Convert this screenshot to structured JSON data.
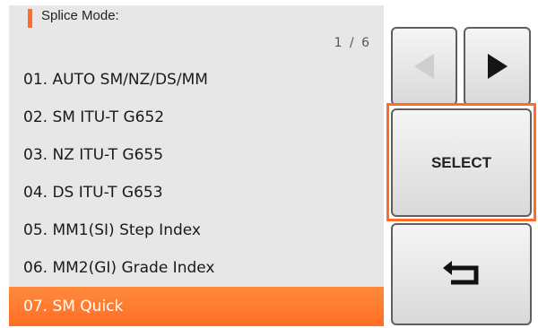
{
  "header": {
    "title": "Splice Mode:"
  },
  "pagination": {
    "indicator": "1 / 6"
  },
  "modes": [
    {
      "label": "01. AUTO SM/NZ/DS/MM"
    },
    {
      "label": "02. SM ITU-T G652"
    },
    {
      "label": "03. NZ ITU-T G655"
    },
    {
      "label": "04. DS ITU-T G653"
    },
    {
      "label": "05. MM1(SI) Step Index"
    },
    {
      "label": "06. MM2(GI) Grade Index"
    },
    {
      "label": "07. SM Quick"
    }
  ],
  "selected_index": 6,
  "buttons": {
    "prev_icon": "triangle-left-icon",
    "next_icon": "triangle-right-icon",
    "select_label": "SELECT",
    "back_icon": "return-arrow-icon"
  },
  "colors": {
    "accent": "#ff6b2c",
    "panel": "#e7e7e7"
  }
}
